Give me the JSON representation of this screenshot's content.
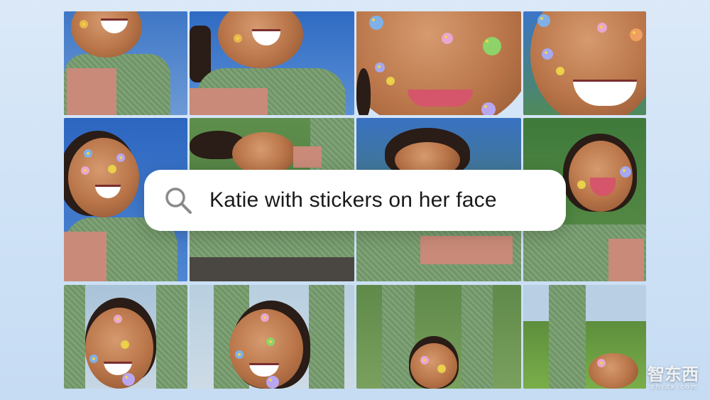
{
  "search": {
    "query": "Katie with stickers on her face",
    "icon": "search-icon"
  },
  "photo_grid": {
    "columns": 4,
    "rows": 3,
    "tiles": [
      {
        "label": "photo-1"
      },
      {
        "label": "photo-2"
      },
      {
        "label": "photo-3"
      },
      {
        "label": "photo-4"
      },
      {
        "label": "photo-5"
      },
      {
        "label": "photo-6"
      },
      {
        "label": "photo-7"
      },
      {
        "label": "photo-8"
      },
      {
        "label": "photo-9"
      },
      {
        "label": "photo-10"
      },
      {
        "label": "photo-11"
      },
      {
        "label": "photo-12"
      }
    ]
  },
  "watermark": {
    "text": "智东西",
    "subtext": "zhidx.com"
  },
  "colors": {
    "background": "#d4e5f7",
    "search_bg": "#ffffff",
    "query_text": "#1a1a1a",
    "icon_gray": "#8a8a8a"
  }
}
